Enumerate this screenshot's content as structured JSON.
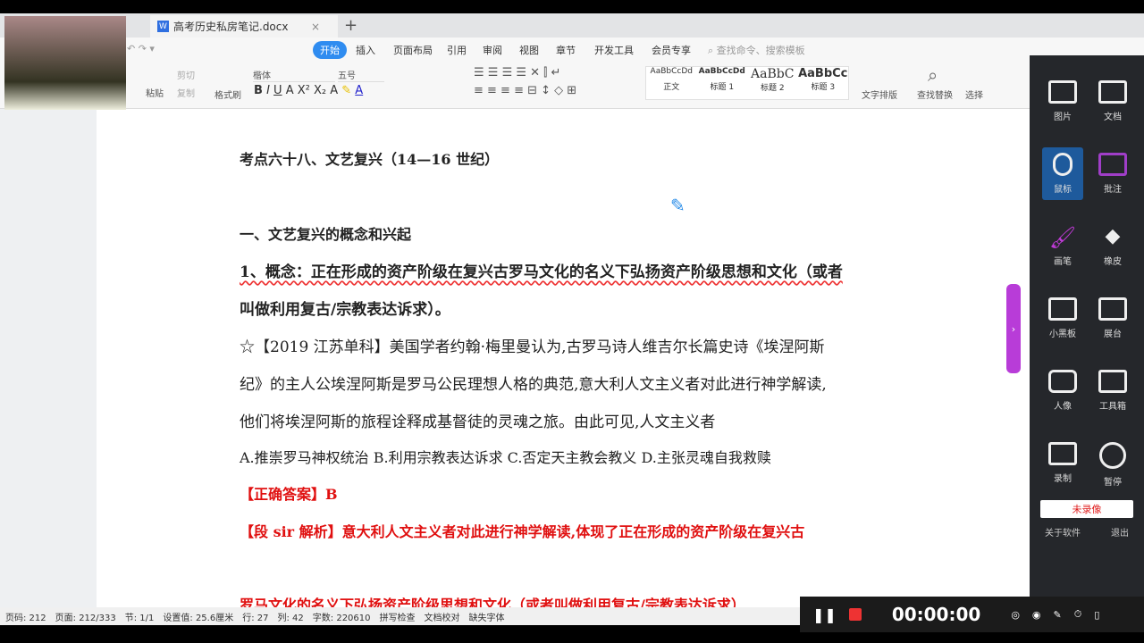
{
  "window": {
    "tab_title": "高考历史私房笔记.docx",
    "new_tab": "+",
    "close": "×"
  },
  "menu": [
    "开始",
    "插入",
    "页面布局",
    "引用",
    "审阅",
    "视图",
    "章节",
    "开发工具",
    "会员专享"
  ],
  "search_placeholder": "查找命令、搜索模板",
  "toolbar": {
    "paste": "粘贴",
    "cut": "剪切",
    "copy": "复制",
    "format_painter": "格式刷",
    "font": "楷体",
    "size": "五号",
    "styles": [
      {
        "preview": "AaBbCcDd",
        "label": "正文"
      },
      {
        "preview": "AaBbCcDd",
        "label": "标题 1"
      },
      {
        "preview": "AaBbC",
        "label": "标题 2"
      },
      {
        "preview": "AaBbCc",
        "label": "标题 3"
      }
    ],
    "layout": "文字排版",
    "find": "查找替换",
    "select": "选择"
  },
  "doc": {
    "title": "考点六十八、文艺复兴（14—16 世纪）",
    "section": "一、文艺复兴的概念和兴起",
    "concept1": "1、概念：正在形成的资产阶级在复兴古罗马文化的名义下弘扬资产阶级思想和文化（或者",
    "concept2": "叫做利用复古/宗教表达诉求）。",
    "q1": "☆【2019 江苏单科】美国学者约翰·梅里曼认为,古罗马诗人维吉尔长篇史诗《埃涅阿斯",
    "q2": "纪》的主人公埃涅阿斯是罗马公民理想人格的典范,意大利人文主义者对此进行神学解读,",
    "q3": "他们将埃涅阿斯的旅程诠释成基督徒的灵魂之旅。由此可见,人文主义者",
    "options": "A.推崇罗马神权统治 B.利用宗教表达诉求 C.否定天主教会教义 D.主张灵魂自我救赎",
    "answer": "【正确答案】B",
    "analysis": "【段 sir 解析】意大利人文主义者对此进行神学解读,体现了正在形成的资产阶级在复兴古",
    "analysis2": "罗马文化的名义下弘扬资产阶级思想和文化（或者叫做利用复古/宗教表达诉求）"
  },
  "status": [
    "页码: 212",
    "页面: 212/333",
    "节: 1/1",
    "设置值: 25.6厘米",
    "行: 27",
    "列: 42",
    "字数: 220610",
    "拼写检查",
    "文档校对",
    "缺失字体"
  ],
  "panel": {
    "items": [
      "图片",
      "文档",
      "鼠标",
      "批注",
      "画笔",
      "橡皮",
      "小黑板",
      "展台",
      "人像",
      "工具箱",
      "录制",
      "暂停"
    ],
    "not_recording": "未录像",
    "about": "关于软件",
    "exit": "退出"
  },
  "recorder": {
    "time": "00:00:00"
  }
}
